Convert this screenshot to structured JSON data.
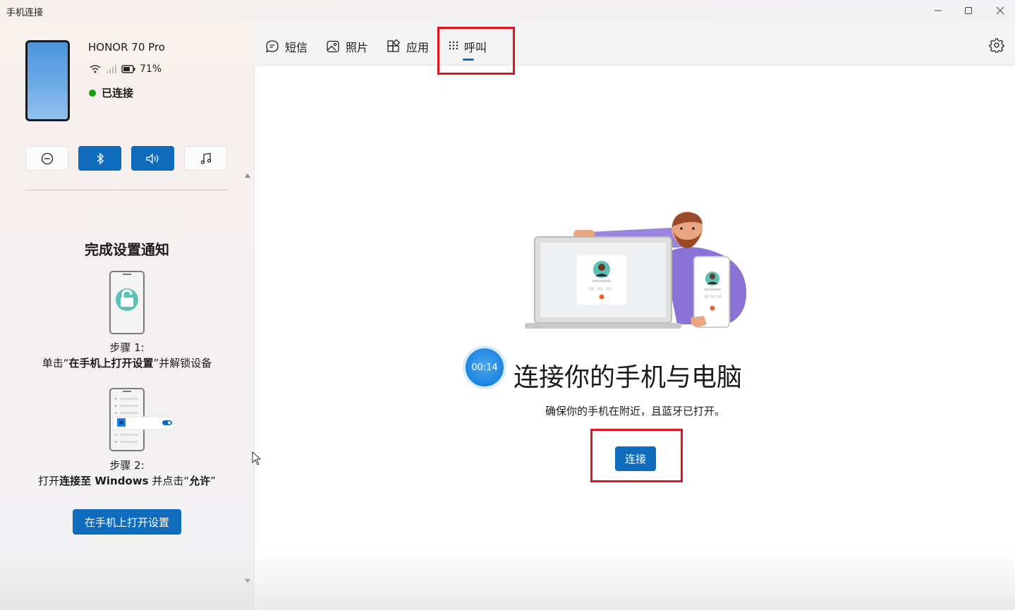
{
  "window": {
    "title": "手机连接",
    "controls": [
      "minimize-icon",
      "maximize-icon",
      "close-icon"
    ]
  },
  "device": {
    "name": "HONOR 70 Pro",
    "battery": "71%",
    "connection_status": "已连接",
    "status_color": "#13a10e"
  },
  "quick_actions": [
    {
      "icon": "do-not-disturb-icon",
      "active": false
    },
    {
      "icon": "bluetooth-icon",
      "active": true
    },
    {
      "icon": "speaker-icon",
      "active": true
    },
    {
      "icon": "music-icon",
      "active": false
    }
  ],
  "setup": {
    "title": "完成设置通知",
    "step1_label": "步骤 1:",
    "step1_prefix": "单击“",
    "step1_bold": "在手机上打开设置",
    "step1_suffix": "”并解锁设备",
    "step2_label": "步骤 2:",
    "step2_prefix": "打开",
    "step2_bold1": "连接至 Windows",
    "step2_middle": " 并点击“",
    "step2_bold2": "允许",
    "step2_suffix": "”",
    "button": "在手机上打开设置"
  },
  "tabs": [
    {
      "label": "短信",
      "icon": "message-icon"
    },
    {
      "label": "照片",
      "icon": "photo-icon"
    },
    {
      "label": "应用",
      "icon": "apps-icon"
    },
    {
      "label": "呼叫",
      "icon": "dialpad-icon",
      "selected": true
    }
  ],
  "main": {
    "timer": "00:14",
    "heading": "连接你的手机与电脑",
    "subtext": "确保你的手机在附近，且蓝牙已打开。",
    "connect_button": "连接"
  },
  "colors": {
    "accent": "#0f6cbd",
    "highlight_box": "#e0141e"
  }
}
